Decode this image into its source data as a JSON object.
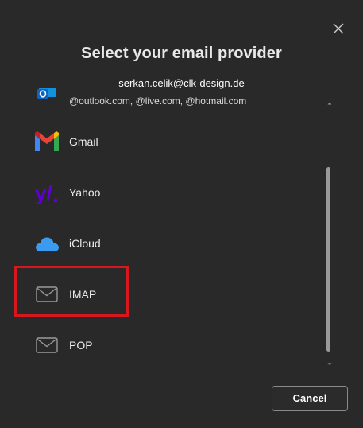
{
  "dialog": {
    "title": "Select your email provider",
    "account_email": "serkan.celik@clk-design.de",
    "cancel_label": "Cancel"
  },
  "providers": [
    {
      "label": "@outlook.com, @live.com, @hotmail.com",
      "icon": "outlook-icon"
    },
    {
      "label": "Gmail",
      "icon": "gmail-icon"
    },
    {
      "label": "Yahoo",
      "icon": "yahoo-icon"
    },
    {
      "label": "iCloud",
      "icon": "icloud-icon"
    },
    {
      "label": "IMAP",
      "icon": "mail-envelope-icon"
    },
    {
      "label": "POP",
      "icon": "mail-envelope-icon"
    }
  ],
  "colors": {
    "background": "#292929",
    "highlight": "#d6181e",
    "yahoo": "#6001d2",
    "icloud": "#3a9bf0"
  }
}
